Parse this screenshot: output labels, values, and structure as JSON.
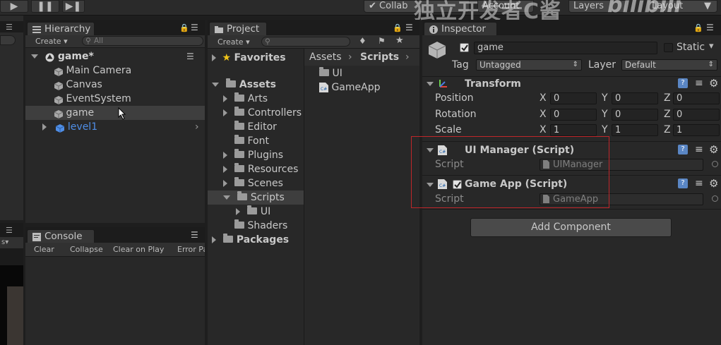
{
  "toolbar": {
    "collab_label": "Collab",
    "account_label": "Account",
    "layers_label": "Layers",
    "layout_label": "Layout",
    "watermark_cn": "独立开发者C酱",
    "watermark_logo": "bilibili"
  },
  "hierarchy": {
    "tab_label": "Hierarchy",
    "create_label": "Create",
    "search_placeholder": "All",
    "scene_name": "game*",
    "items": [
      {
        "label": "Main Camera"
      },
      {
        "label": "Canvas"
      },
      {
        "label": "EventSystem"
      },
      {
        "label": "game"
      },
      {
        "label": "level1"
      }
    ]
  },
  "console": {
    "tab_label": "Console",
    "buttons": [
      "Clear",
      "Collapse",
      "Clear on Play",
      "Error Pause"
    ]
  },
  "project": {
    "tab_label": "Project",
    "create_label": "Create",
    "favorites_label": "Favorites",
    "assets_label": "Assets",
    "folders": [
      "Arts",
      "Controllers",
      "Editor",
      "Font",
      "Plugins",
      "Resources",
      "Scenes",
      "Scripts",
      "UI",
      "Shaders"
    ],
    "packages_label": "Packages",
    "breadcrumb": [
      "Assets",
      "Scripts"
    ],
    "contents": [
      {
        "label": "UI",
        "kind": "folder"
      },
      {
        "label": "GameApp",
        "kind": "script"
      }
    ]
  },
  "inspector": {
    "tab_label": "Inspector",
    "object_name": "game",
    "static_label": "Static",
    "tag_label": "Tag",
    "tag_value": "Untagged",
    "layer_label": "Layer",
    "layer_value": "Default",
    "transform": {
      "title": "Transform",
      "position_label": "Position",
      "rotation_label": "Rotation",
      "scale_label": "Scale",
      "axis_x": "X",
      "axis_y": "Y",
      "axis_z": "Z",
      "position": [
        "0",
        "0",
        "0"
      ],
      "rotation": [
        "0",
        "0",
        "0"
      ],
      "scale": [
        "1",
        "1",
        "1"
      ]
    },
    "ui_manager": {
      "title": "UI Manager (Script)",
      "script_label": "Script",
      "script_value": "UIManager"
    },
    "game_app": {
      "title": "Game App (Script)",
      "script_label": "Script",
      "script_value": "GameApp"
    },
    "add_component_label": "Add Component"
  },
  "colors": {
    "highlight_box": "#c0262a",
    "link_blue": "#4f8ee6",
    "selected_row": "#3e3e3e"
  }
}
